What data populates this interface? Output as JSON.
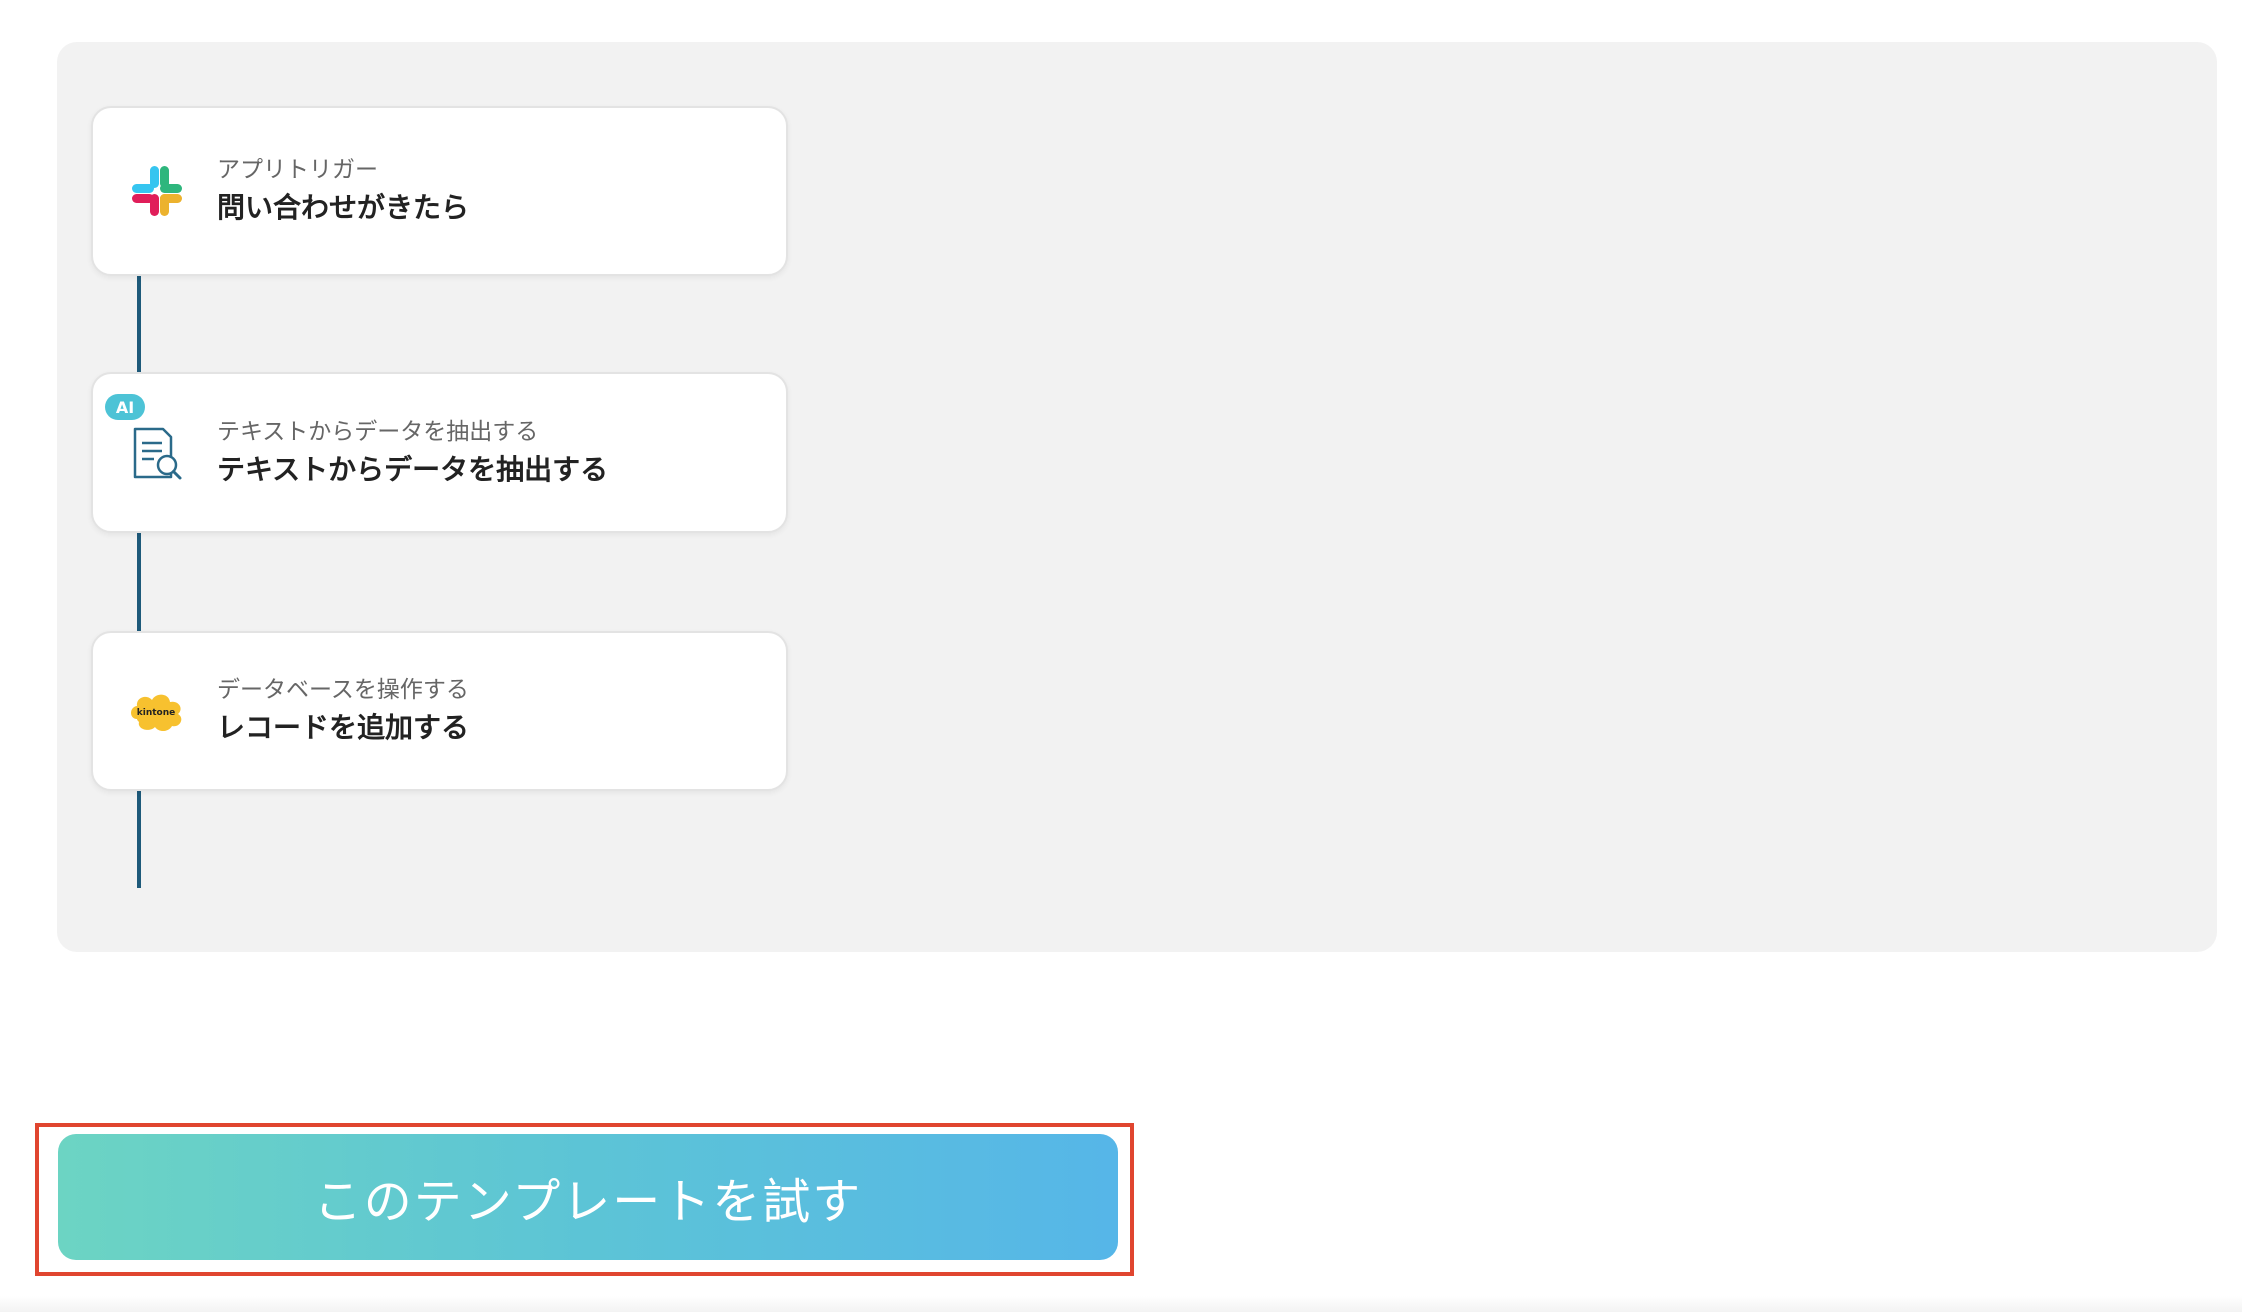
{
  "flow": {
    "steps": [
      {
        "subtitle": "アプリトリガー",
        "title": "問い合わせがきたら",
        "icon": "slack-icon"
      },
      {
        "subtitle": "テキストからデータを抽出する",
        "title": "テキストからデータを抽出する",
        "icon": "document-search-icon",
        "badge": "AI"
      },
      {
        "subtitle": "データベースを操作する",
        "title": "レコードを追加する",
        "icon": "kintone-icon",
        "icon_text": "kintone"
      }
    ]
  },
  "cta": {
    "label": "このテンプレートを試す"
  },
  "colors": {
    "panel_bg": "#f2f2f2",
    "connector": "#1e5a7a",
    "button_gradient_start": "#6cd4c3",
    "button_gradient_end": "#56b6e8",
    "highlight_border": "#e0452f",
    "ai_badge": "#4dc3d6",
    "kintone_yellow": "#f7c12f"
  }
}
